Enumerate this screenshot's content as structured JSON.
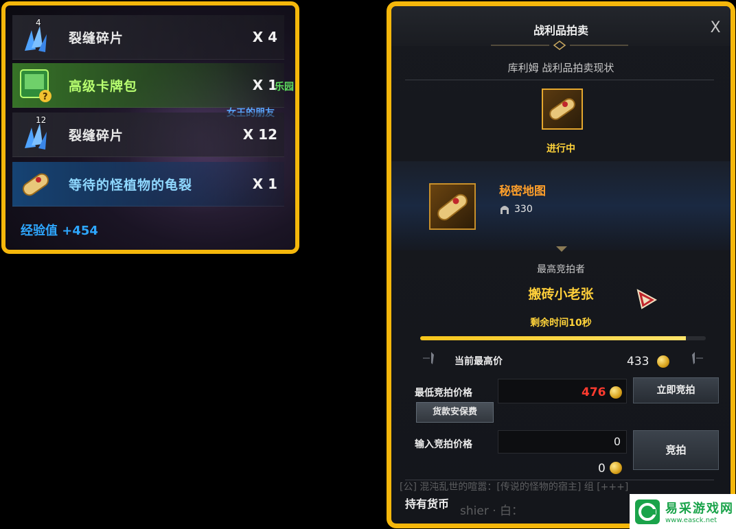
{
  "loot": {
    "items": [
      {
        "name": "裂缝碎片",
        "qty": "X 4",
        "stack": "4",
        "icon": "crystal-shard-icon",
        "style": "default"
      },
      {
        "name": "高级卡牌包",
        "qty": "X 1",
        "stack": "",
        "icon": "card-pack-icon",
        "style": "green"
      },
      {
        "name": "裂缝碎片",
        "qty": "X 12",
        "stack": "12",
        "icon": "crystal-shard-icon",
        "style": "default"
      },
      {
        "name": "等待的怪植物的龟裂",
        "qty": "X 1",
        "stack": "",
        "icon": "scroll-icon",
        "style": "blue"
      }
    ],
    "bg_text_1": "乐园",
    "bg_text_2": "女王的朋友",
    "exp": "经验值 +454"
  },
  "auction": {
    "title": "战利品拍卖",
    "close": "X",
    "subtitle": "库利姆 战利品拍卖现状",
    "status": "进行中",
    "item": {
      "name": "秘密地图",
      "level": "330"
    },
    "top_bidder_label": "最高竞拍者",
    "top_bidder_name": "搬砖小老张",
    "remaining": "剩余时间10秒",
    "remaining_fraction": 0.93,
    "current_high_label": "当前最高价",
    "current_high_value": "433",
    "min_bid_label": "最低竞拍价格",
    "min_bid_value": "476",
    "instant_bid_button": "立即竞拍",
    "fee_button": "货款安保费",
    "input_label": "输入竞拍价格",
    "input_value": "0",
    "cost_value": "0",
    "bid_button": "竞拍",
    "holding_label": "持有货币",
    "chat_line": "[公] 混沌乱世的喧嚣：[传说的怪物的宿主] 组 [+++]",
    "chat_line2": "shier · 白：",
    "colors": {
      "border": "#f5b70b",
      "highlight": "#ffcf3a",
      "min_bid": "#ff3b2f",
      "item_name": "#ff9f2a"
    }
  },
  "watermark": {
    "title": "易采游戏网",
    "url": "www.easck.net"
  }
}
